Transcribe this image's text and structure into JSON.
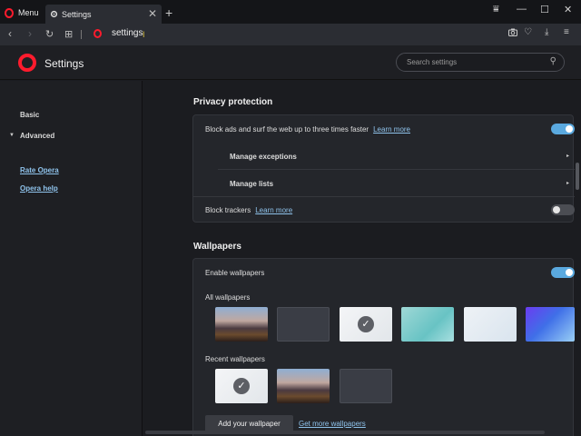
{
  "browser": {
    "menu_label": "Menu",
    "tab_title": "Settings",
    "tab_close": "✕",
    "new_tab": "+",
    "window_controls": {
      "filter": "⩸",
      "minimize": "—",
      "maximize": "☐",
      "close": "✕"
    },
    "nav": {
      "back": "‹",
      "forward": "›",
      "reload": "↻",
      "grid": "⊞"
    },
    "address": "settings",
    "cursor": "I",
    "tools": {
      "camera": "📷",
      "heart": "♡",
      "download": "⤓",
      "easy_setup": "≡"
    }
  },
  "header": {
    "title": "Settings",
    "search_placeholder": "Search settings",
    "search_icon": "⚲"
  },
  "sidebar": {
    "items": [
      "Basic",
      "Advanced"
    ],
    "advanced_caret": "▼",
    "links": [
      "Rate Opera",
      "Opera help"
    ]
  },
  "privacy": {
    "title": "Privacy protection",
    "block_ads_label": "Block ads and surf the web up to three times faster",
    "block_ads_link": "Learn more",
    "block_ads_enabled": true,
    "manage_exceptions": "Manage exceptions",
    "manage_lists": "Manage lists",
    "arrow": "▸",
    "block_trackers_label": "Block trackers",
    "block_trackers_link": "Learn more",
    "block_trackers_enabled": false
  },
  "wallpapers": {
    "title": "Wallpapers",
    "enable_label": "Enable wallpapers",
    "enabled": true,
    "all_label": "All wallpapers",
    "recent_label": "Recent wallpapers",
    "selected_mark": "✓",
    "add_button": "Add your wallpaper",
    "get_more": "Get more wallpapers"
  },
  "colors": {
    "accent": "#5aa9df",
    "opera_red": "#ff1b2d",
    "link": "#8fc3ec"
  }
}
